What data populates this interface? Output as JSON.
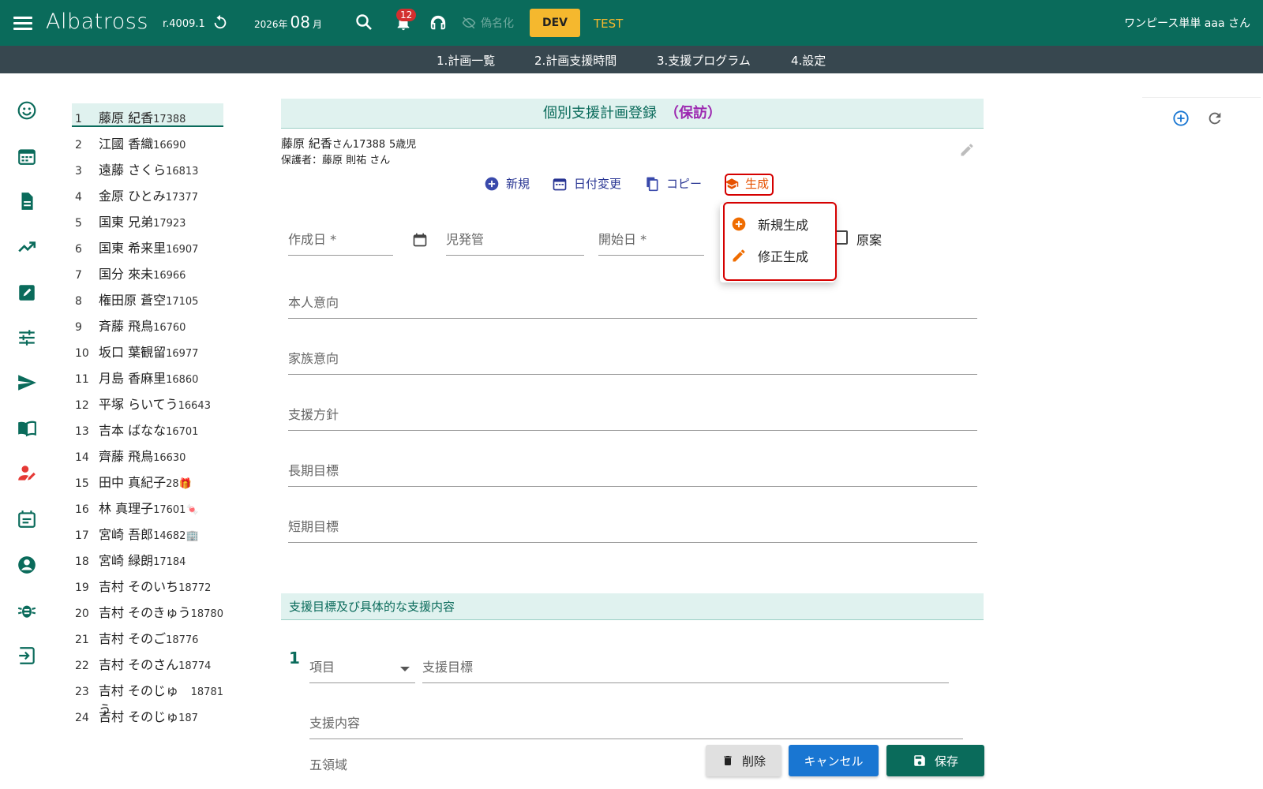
{
  "app": {
    "brand": "Albatross",
    "version": "r.4009.1",
    "date_year": "2026年",
    "date_month_num": "08",
    "date_month_suffix": "月",
    "notification_count": "12",
    "pseudonymize_label": "偽名化",
    "env_dev": "DEV",
    "env_test": "TEST",
    "user": "ワンピース単単 aaa さん",
    "colors": {
      "primary": "#0a6b5b",
      "subnav": "#37474f",
      "accent": "#f5b82e",
      "generate": "#e65100",
      "cancel": "#1976d2"
    }
  },
  "tabs": [
    "1.計画一覧",
    "2.計画支援時間",
    "3.支援プログラム",
    "4.設定"
  ],
  "rail_icons": [
    "smile-icon",
    "calendar-icon",
    "document-icon",
    "trending-icon",
    "edit-square-icon",
    "tune-icon",
    "send-icon",
    "book-icon",
    "person-edit-icon",
    "event-note-icon",
    "account-circle-icon",
    "bug-icon",
    "logout-icon"
  ],
  "children": [
    {
      "n": "1",
      "name": "藤原 紀香",
      "id": "17388",
      "selected": true
    },
    {
      "n": "2",
      "name": "江國 香織",
      "id": "16690"
    },
    {
      "n": "3",
      "name": "遠藤 さくら",
      "id": "16813"
    },
    {
      "n": "4",
      "name": "金原 ひとみ",
      "id": "17377"
    },
    {
      "n": "5",
      "name": "国東 兄弟",
      "id": "17923"
    },
    {
      "n": "6",
      "name": "国東 希来里",
      "id": "16907"
    },
    {
      "n": "7",
      "name": "国分 來未",
      "id": "16966"
    },
    {
      "n": "8",
      "name": "権田原 蒼空",
      "id": "17105"
    },
    {
      "n": "9",
      "name": "斉藤 飛鳥",
      "id": "16760"
    },
    {
      "n": "10",
      "name": "坂口 葉観留",
      "id": "16977"
    },
    {
      "n": "11",
      "name": "月島 香麻里",
      "id": "16860"
    },
    {
      "n": "12",
      "name": "平塚 らいてう",
      "id": "16643"
    },
    {
      "n": "13",
      "name": "吉本 ばなな",
      "id": "16701"
    },
    {
      "n": "14",
      "name": "齊藤 飛鳥",
      "id": "16630"
    },
    {
      "n": "15",
      "name": "田中 真紀子",
      "id": "28",
      "badge": "🎁"
    },
    {
      "n": "16",
      "name": "林 真理子",
      "id": "17601",
      "badge": "🍬"
    },
    {
      "n": "17",
      "name": "宮崎 吾郎",
      "id": "14682",
      "badge": "🏢"
    },
    {
      "n": "18",
      "name": "宮崎 緑朗",
      "id": "17184"
    },
    {
      "n": "19",
      "name": "吉村 そのいち",
      "id": "18772"
    },
    {
      "n": "20",
      "name": "吉村 そのきゅう",
      "id": "18780"
    },
    {
      "n": "21",
      "name": "吉村 そのご",
      "id": "18776"
    },
    {
      "n": "22",
      "name": "吉村 そのさん",
      "id": "18774"
    },
    {
      "n": "23",
      "name": "吉村 そのじゅう",
      "id": "18781"
    },
    {
      "n": "24",
      "name": "吉村 そのじゅ",
      "id": "187"
    }
  ],
  "form": {
    "title": "個別支援計画登録",
    "title_tag": "（保訪）",
    "child_name": "藤原 紀香",
    "child_suffix": "さん",
    "child_id": "17388",
    "child_age": "5歳児",
    "guardian": "保護者：藤原 則祐 さん",
    "actions": {
      "new": "新規",
      "date_change": "日付変更",
      "copy": "コピー",
      "generate": "生成"
    },
    "menu": {
      "new_generate": "新規生成",
      "revise_generate": "修正生成"
    },
    "fields": {
      "created_date": "作成日 *",
      "center": "児発管",
      "start_date": "開始日 *",
      "draft": "原案",
      "self_intent": "本人意向",
      "family_intent": "家族意向",
      "policy": "支援方針",
      "long_goal": "長期目標",
      "short_goal": "短期目標"
    },
    "section_title": "支援目標及び具体的な支援内容",
    "row_number": "1",
    "row_fields": {
      "item": "項目",
      "goal": "支援目標",
      "content": "支援内容",
      "five_domains": "五領域"
    },
    "buttons": {
      "delete": "削除",
      "cancel": "キャンセル",
      "save": "保存"
    }
  }
}
